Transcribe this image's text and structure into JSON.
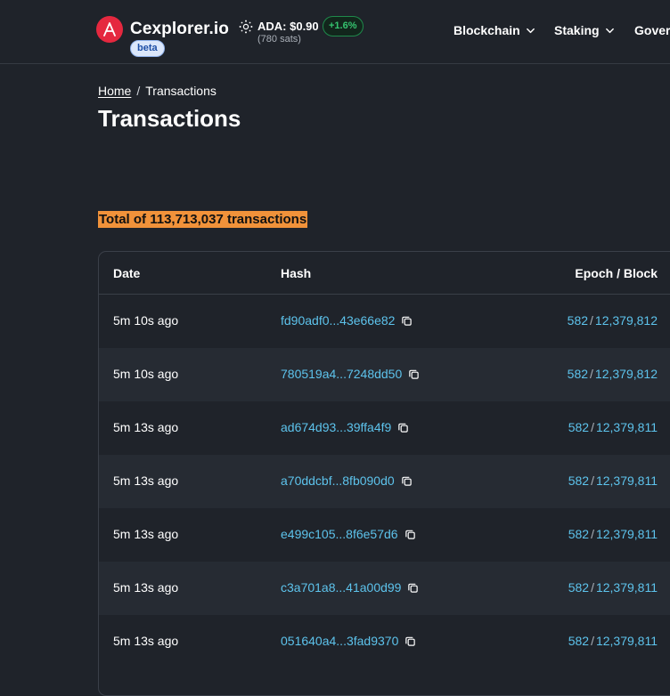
{
  "header": {
    "logo_text": "Cexplorer.io",
    "beta": "beta",
    "ada_price": "ADA: $0.90",
    "ada_change": "+1.6%",
    "ada_sats": "(780 sats)",
    "nav": [
      "Blockchain",
      "Staking",
      "Gover"
    ]
  },
  "breadcrumb": {
    "home": "Home",
    "separator": "/",
    "current": "Transactions"
  },
  "page_title": "Transactions",
  "total_label": "Total of 113,713,037 transactions",
  "table": {
    "headers": [
      "Date",
      "Hash",
      "Epoch / Block"
    ],
    "rows": [
      {
        "date": "5m 10s ago",
        "hash": "fd90adf0...43e66e82",
        "epoch": "582",
        "block": "12,379,812"
      },
      {
        "date": "5m 10s ago",
        "hash": "780519a4...7248dd50",
        "epoch": "582",
        "block": "12,379,812"
      },
      {
        "date": "5m 13s ago",
        "hash": "ad674d93...39ffa4f9",
        "epoch": "582",
        "block": "12,379,811"
      },
      {
        "date": "5m 13s ago",
        "hash": "a70ddcbf...8fb090d0",
        "epoch": "582",
        "block": "12,379,811"
      },
      {
        "date": "5m 13s ago",
        "hash": "e499c105...8f6e57d6",
        "epoch": "582",
        "block": "12,379,811"
      },
      {
        "date": "5m 13s ago",
        "hash": "c3a701a8...41a00d99",
        "epoch": "582",
        "block": "12,379,811"
      },
      {
        "date": "5m 13s ago",
        "hash": "051640a4...3fad9370",
        "epoch": "582",
        "block": "12,379,811"
      }
    ]
  },
  "colors": {
    "background": "#1f232a",
    "brand_red": "#e5283f",
    "link": "#5dc3ec",
    "highlight": "#f1923a",
    "positive": "#35c46f"
  },
  "icons": {
    "logo": "cexplorer-logo-icon",
    "ada": "cardano-icon",
    "chevron": "chevron-down-icon",
    "copy": "copy-icon"
  }
}
